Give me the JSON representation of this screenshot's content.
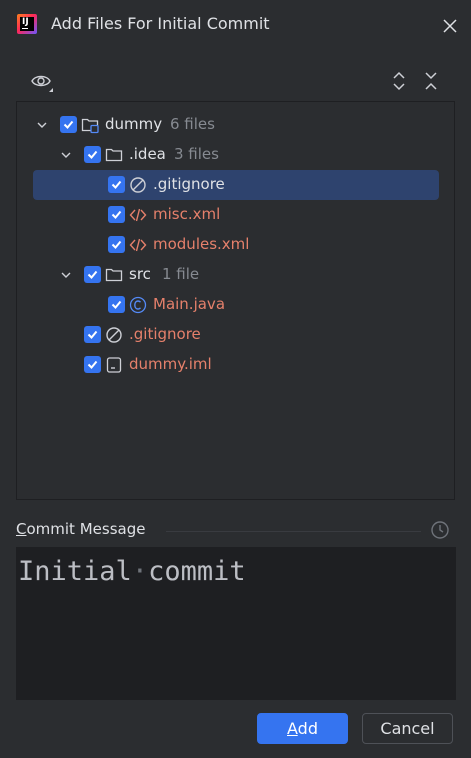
{
  "dialog": {
    "title": "Add Files For Initial Commit",
    "icons": {
      "app": "intellij-idea-logo-icon",
      "close": "close-icon"
    }
  },
  "toolbar": {
    "view_options": "eye-icon",
    "expand_all": "expand-all-icon",
    "collapse_all": "collapse-all-icon"
  },
  "tree": {
    "items": [
      {
        "label": "dummy",
        "count": "6 files",
        "icon": "module-folder-icon",
        "checked": true,
        "expanded": true,
        "depth": 0,
        "status": "normal"
      },
      {
        "label": ".idea",
        "count": "3 files",
        "icon": "folder-icon",
        "checked": true,
        "expanded": true,
        "depth": 1,
        "status": "normal"
      },
      {
        "label": ".gitignore",
        "icon": "ignored-file-icon",
        "checked": true,
        "depth": 2,
        "status": "normal",
        "selected": true
      },
      {
        "label": "misc.xml",
        "icon": "xml-file-icon",
        "checked": true,
        "depth": 2,
        "status": "new"
      },
      {
        "label": "modules.xml",
        "icon": "xml-file-icon",
        "checked": true,
        "depth": 2,
        "status": "new"
      },
      {
        "label": "src",
        "count": "1 file",
        "icon": "folder-icon",
        "checked": true,
        "expanded": true,
        "depth": 1,
        "status": "normal"
      },
      {
        "label": "Main.java",
        "icon": "java-class-icon",
        "checked": true,
        "depth": 2,
        "status": "new"
      },
      {
        "label": ".gitignore",
        "icon": "ignored-file-icon",
        "checked": true,
        "depth": 1,
        "status": "new"
      },
      {
        "label": "dummy.iml",
        "icon": "iml-file-icon",
        "checked": true,
        "depth": 1,
        "status": "new"
      }
    ]
  },
  "commit": {
    "label_mnemonic": "C",
    "label_rest": "ommit Message",
    "history_icon": "history-clock-icon",
    "message_word1": "Initial",
    "message_word2": "commit"
  },
  "buttons": {
    "add_mnemonic": "A",
    "add_rest": "dd",
    "cancel": "Cancel"
  },
  "colors": {
    "background": "#2b2d30",
    "accent": "#3574f0",
    "selection": "#2e436e",
    "new_file": "#e5806b",
    "muted": "#868a91"
  }
}
